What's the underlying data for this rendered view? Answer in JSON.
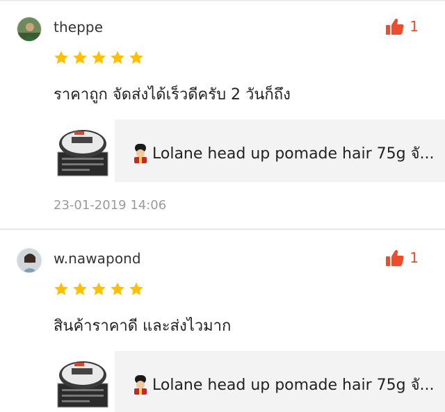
{
  "colors": {
    "accent": "#ee4d2d",
    "star": "#ffc000",
    "card_bg": "#f3f3f3",
    "muted": "#9a9a9a"
  },
  "reviews": [
    {
      "username": "theppe",
      "like_count": "1",
      "rating": 5,
      "comment": "ราคาถูก จัดส่งได้เร็วดีครับ 2 วันก็ถึง",
      "product_name": "Lolane head up pomade hair 75g จั...",
      "timestamp": "23-01-2019 14:06",
      "icons": {
        "avatar": "avatar-image",
        "like": "thumbs-up-icon",
        "star": "star-icon",
        "product_emoji": "guard-emoji-icon"
      }
    },
    {
      "username": "w.nawapond",
      "like_count": "1",
      "rating": 5,
      "comment": "สินค้าราคาดี และส่งไวมาก",
      "product_name": "Lolane head up pomade hair 75g จั...",
      "icons": {
        "avatar": "avatar-image",
        "like": "thumbs-up-icon",
        "star": "star-icon",
        "product_emoji": "guard-emoji-icon"
      }
    }
  ]
}
